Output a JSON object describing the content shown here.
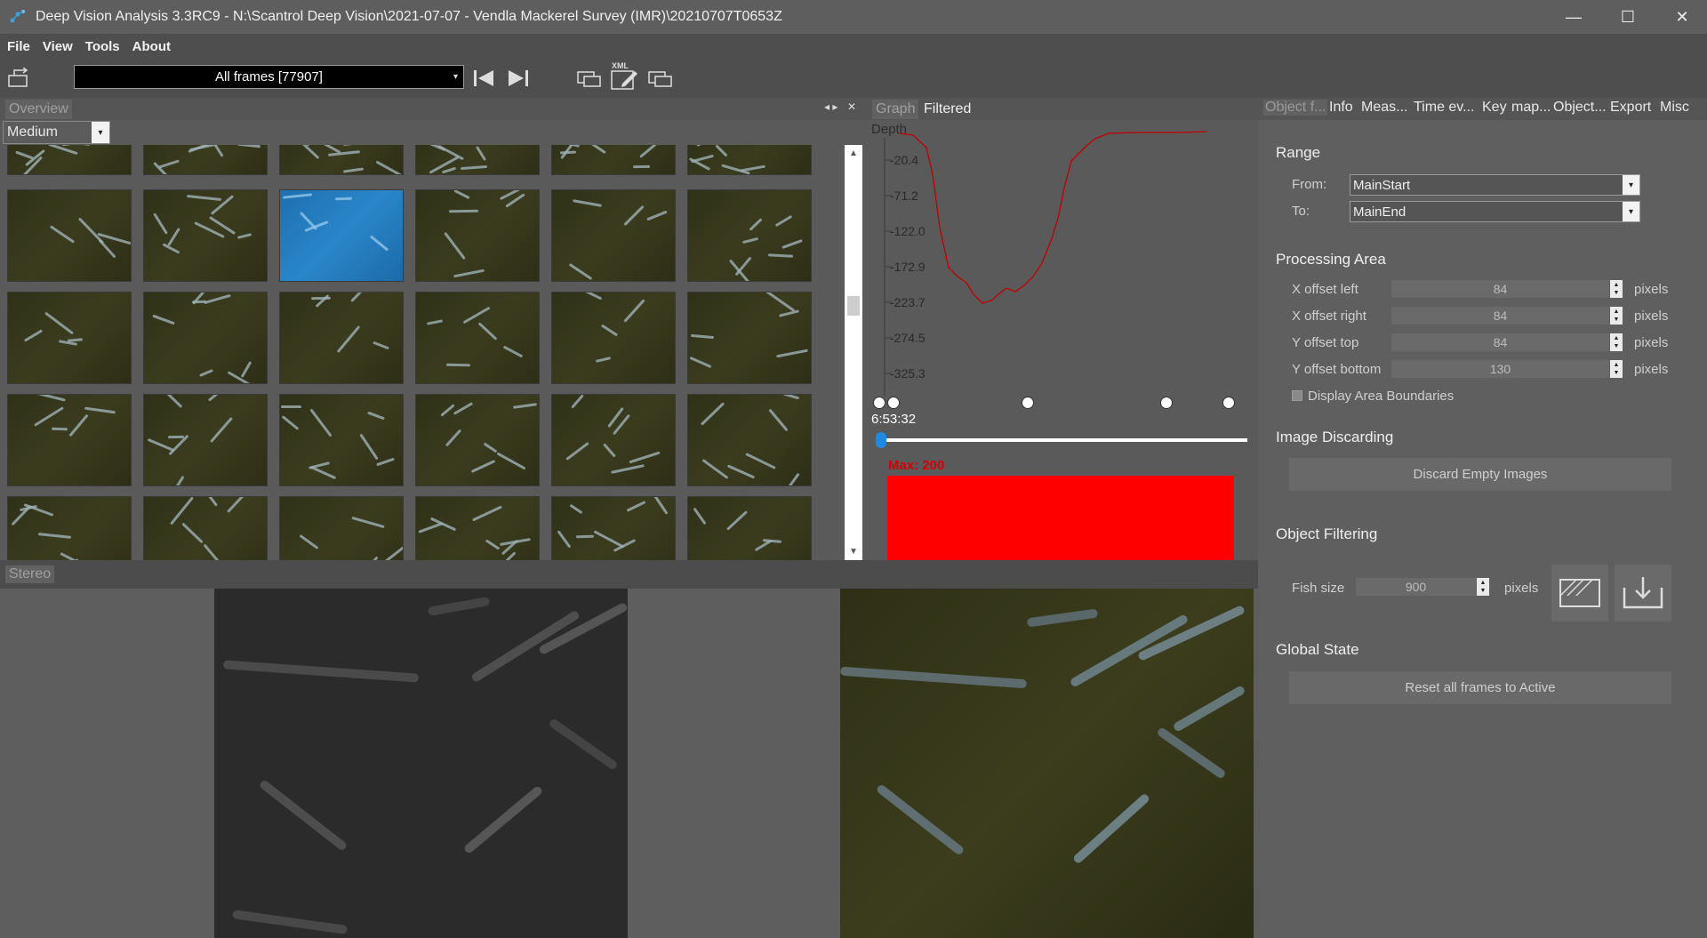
{
  "window": {
    "title": "Deep Vision Analysis 3.3RC9 - N:\\Scantrol Deep Vision\\2021-07-07 - Vendla Mackerel Survey (IMR)\\20210707T0653Z",
    "minimize": "—",
    "maximize": "☐",
    "close": "✕"
  },
  "menu": [
    "File",
    "View",
    "Tools",
    "About"
  ],
  "toolbar": {
    "frames_select": "All frames [77907]",
    "xml_label": "XML"
  },
  "overview": {
    "tab": "Overview",
    "size_select": "Medium"
  },
  "graph": {
    "tab_graph": "Graph",
    "tab_filtered": "Filtered",
    "depth_label": "Depth",
    "yticks": [
      "-20.4",
      "-71.2",
      "-122.0",
      "-172.9",
      "-223.7",
      "-274.5",
      "-325.3"
    ],
    "time": "6:53:32",
    "max_label": "Max: 200",
    "line_color": "#c00000"
  },
  "right_tabs": [
    "Object f...",
    "Info",
    "Meas...",
    "Time ev...",
    "Key",
    "map...",
    "Object...",
    "Export",
    "Misc"
  ],
  "filter_panel": {
    "range_title": "Range",
    "from_label": "From:",
    "from_value": "MainStart",
    "to_label": "To:",
    "to_value": "MainEnd",
    "processing_title": "Processing Area",
    "x_left_label": "X offset left",
    "x_left_value": "84",
    "x_right_label": "X offset right",
    "x_right_value": "84",
    "y_top_label": "Y offset top",
    "y_top_value": "84",
    "y_bottom_label": "Y offset bottom",
    "y_bottom_value": "130",
    "pixels": "pixels",
    "display_boundaries": "Display Area Boundaries",
    "discarding_title": "Image Discarding",
    "discard_button": "Discard Empty Images",
    "object_filtering_title": "Object Filtering",
    "fish_size_label": "Fish size",
    "fish_size_value": "900",
    "global_title": "Global State",
    "reset_button": "Reset all frames to Active"
  },
  "stereo": {
    "tab": "Stereo"
  }
}
